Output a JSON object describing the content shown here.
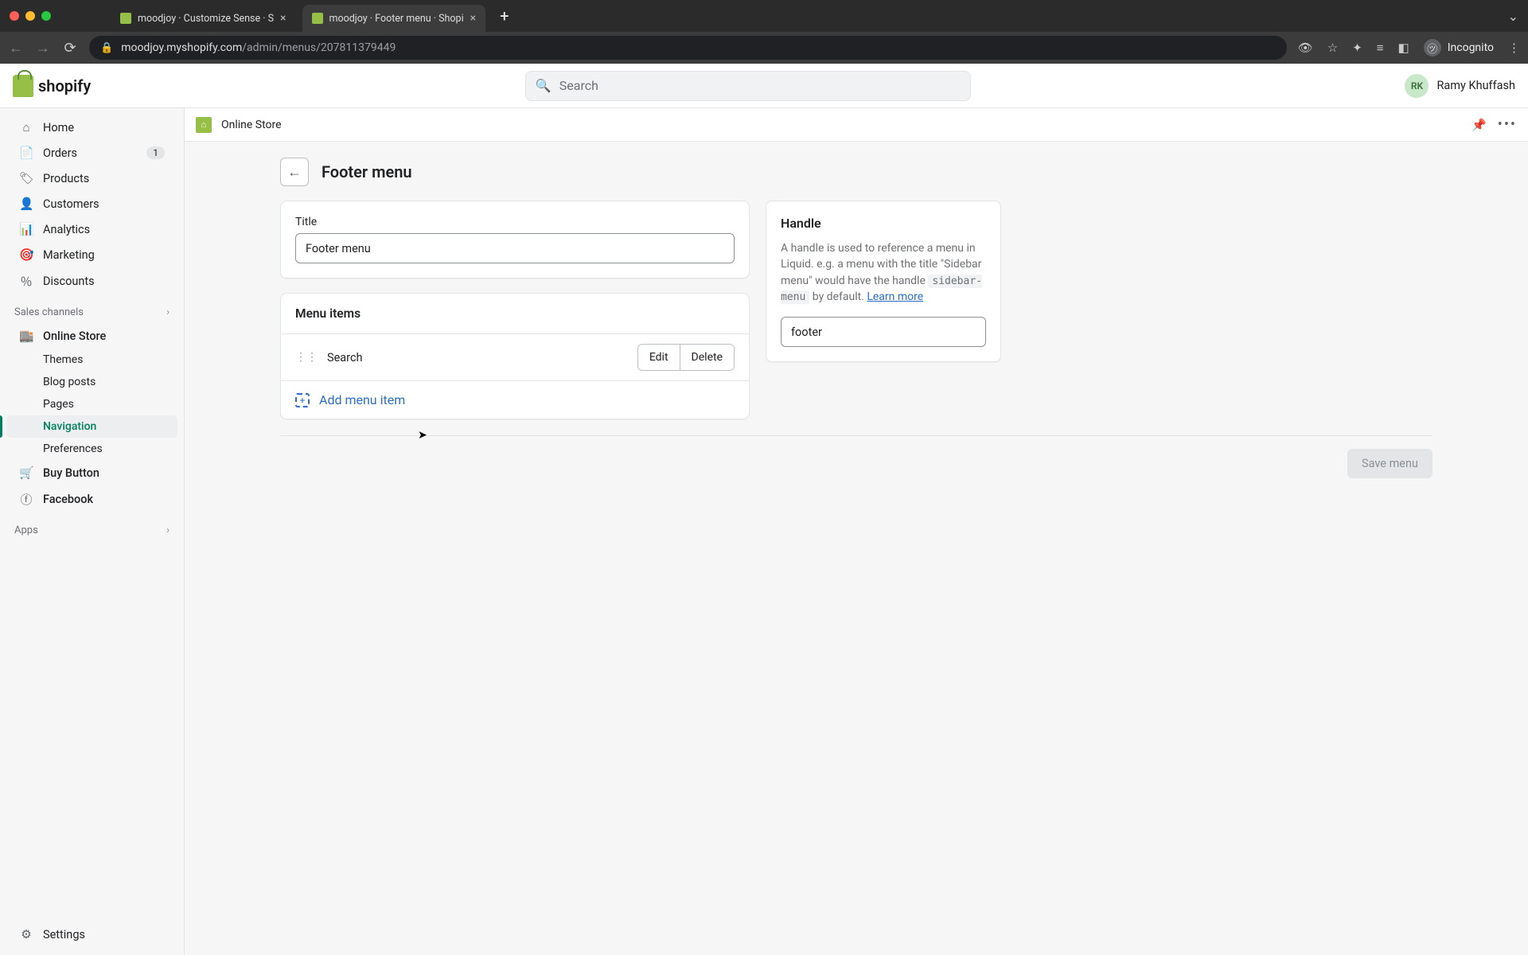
{
  "browser": {
    "tabs": [
      {
        "title": "moodjoy · Customize Sense · S"
      },
      {
        "title": "moodjoy · Footer menu · Shopi"
      }
    ],
    "url_host": "moodjoy.myshopify.com",
    "url_path": "/admin/menus/207811379449",
    "incognito_label": "Incognito"
  },
  "topbar": {
    "logo_text": "shopify",
    "search_placeholder": "Search",
    "user_initials": "RK",
    "user_name": "Ramy Khuffash"
  },
  "sidebar": {
    "items": [
      {
        "label": "Home",
        "icon": "⌂"
      },
      {
        "label": "Orders",
        "icon": "✉",
        "badge": "1"
      },
      {
        "label": "Products",
        "icon": "❖"
      },
      {
        "label": "Customers",
        "icon": "👤"
      },
      {
        "label": "Analytics",
        "icon": "⫿"
      },
      {
        "label": "Marketing",
        "icon": "◎"
      },
      {
        "label": "Discounts",
        "icon": "%"
      }
    ],
    "sales_channels_label": "Sales channels",
    "online_store": {
      "label": "Online Store",
      "sub": [
        {
          "label": "Themes"
        },
        {
          "label": "Blog posts"
        },
        {
          "label": "Pages"
        },
        {
          "label": "Navigation",
          "active": true
        },
        {
          "label": "Preferences"
        }
      ]
    },
    "buy_button_label": "Buy Button",
    "facebook_label": "Facebook",
    "apps_label": "Apps",
    "settings_label": "Settings"
  },
  "context": {
    "title": "Online Store"
  },
  "page": {
    "title": "Footer menu",
    "title_field_label": "Title",
    "title_value": "Footer menu",
    "menu_items_header": "Menu items",
    "menu_item_0": "Search",
    "edit_label": "Edit",
    "delete_label": "Delete",
    "add_menu_item_label": "Add menu item",
    "handle_title": "Handle",
    "handle_desc_1": "A handle is used to reference a menu in Liquid. e.g. a menu with the title \"Sidebar menu\" would have the handle ",
    "handle_code": "sidebar-menu",
    "handle_desc_2": " by default. ",
    "handle_learn": "Learn more",
    "handle_value": "footer",
    "save_label": "Save menu"
  }
}
